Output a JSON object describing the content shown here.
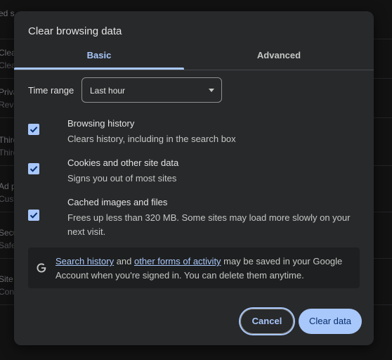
{
  "background": {
    "left_rows": [
      {
        "line1": "ed s",
        "line2": ""
      },
      {
        "line1": "Clear",
        "line2": "Clear"
      },
      {
        "line1": "Priva",
        "line2": "Revie"
      },
      {
        "line1": "Third",
        "line2": "Third"
      },
      {
        "line1": "Ad p",
        "line2": "Custo"
      },
      {
        "line1": "Secu",
        "line2": "Safe"
      },
      {
        "line1": "Site s",
        "line2": "Cont"
      }
    ]
  },
  "dialog": {
    "title": "Clear browsing data",
    "tabs": [
      {
        "label": "Basic",
        "selected": true
      },
      {
        "label": "Advanced",
        "selected": false
      }
    ],
    "time_range": {
      "label": "Time range",
      "value": "Last hour"
    },
    "options": [
      {
        "title": "Browsing history",
        "description": "Clears history, including in the search box",
        "checked": true
      },
      {
        "title": "Cookies and other site data",
        "description": "Signs you out of most sites",
        "checked": true
      },
      {
        "title": "Cached images and files",
        "description": "Frees up less than 320 MB. Some sites may load more slowly on your next visit.",
        "checked": true
      }
    ],
    "info": {
      "icon": "google-g-icon",
      "link1": "Search history",
      "text1": " and ",
      "link2": "other forms of activity",
      "text2": " may be saved in your Google Account when you're signed in. You can delete them anytime."
    },
    "buttons": {
      "cancel": "Cancel",
      "clear": "Clear data"
    }
  },
  "colors": {
    "accent": "#a8c7fa",
    "dialog_bg": "#28292b",
    "text": "#e3e3e3"
  }
}
